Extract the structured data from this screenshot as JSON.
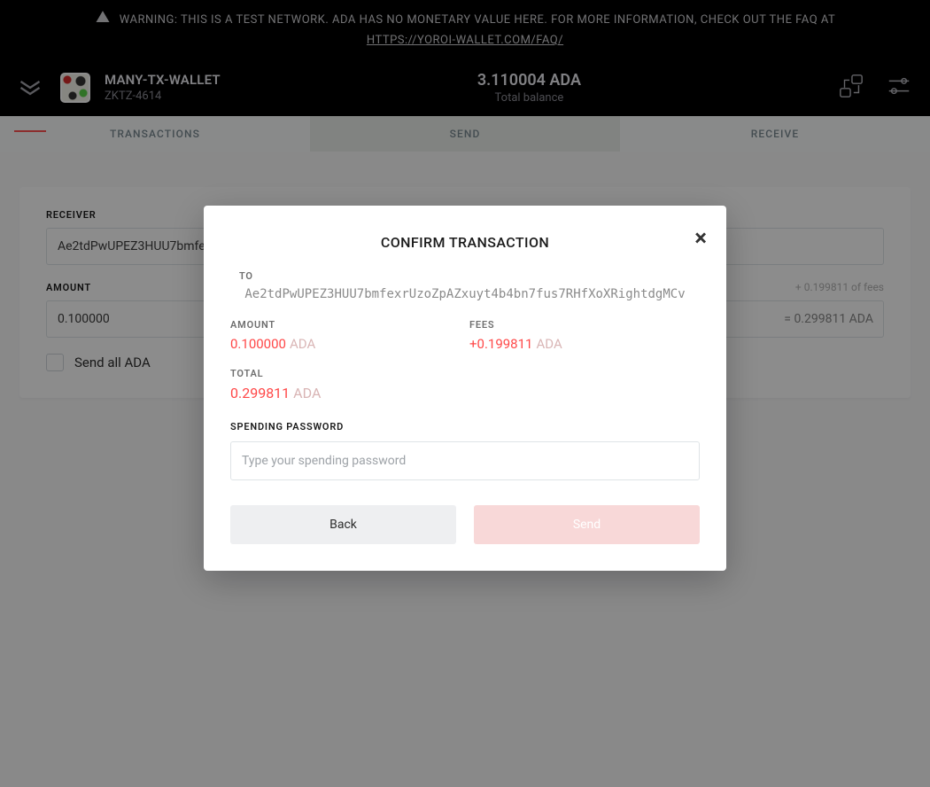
{
  "banner": {
    "text": "WARNING: THIS IS A TEST NETWORK. ADA HAS NO MONETARY VALUE HERE. FOR MORE INFORMATION, CHECK OUT THE FAQ AT",
    "link": "HTTPS://YOROI-WALLET.COM/FAQ/"
  },
  "header": {
    "wallet_name": "MANY-TX-WALLET",
    "wallet_plate": "ZKTZ-4614",
    "balance": "3.110004 ADA",
    "balance_label": "Total balance"
  },
  "tabs": {
    "transactions": "TRANSACTIONS",
    "send": "SEND",
    "receive": "RECEIVE"
  },
  "form": {
    "receiver_label": "RECEIVER",
    "receiver_value": "Ae2tdPwUPEZ3HUU7bmfe…",
    "amount_label": "AMOUNT",
    "fee_hint": "+ 0.199811 of fees",
    "amount_value": "0.100000",
    "amount_eq": "= 0.299811 ADA",
    "send_all_label": "Send all ADA"
  },
  "modal": {
    "title": "CONFIRM TRANSACTION",
    "to_label": "TO",
    "to_addr": "Ae2tdPwUPEZ3HUU7bmfexrUzoZpAZxuyt4b4bn7fus7RHfXoXRightdgMCv",
    "amount_label": "AMOUNT",
    "amount_value": "0.100000",
    "amount_unit": "ADA",
    "fees_label": "FEES",
    "fees_value": "+0.199811",
    "fees_unit": "ADA",
    "total_label": "TOTAL",
    "total_value": "0.299811",
    "total_unit": "ADA",
    "pw_label": "SPENDING PASSWORD",
    "pw_placeholder": "Type your spending password",
    "back_btn": "Back",
    "send_btn": "Send"
  }
}
